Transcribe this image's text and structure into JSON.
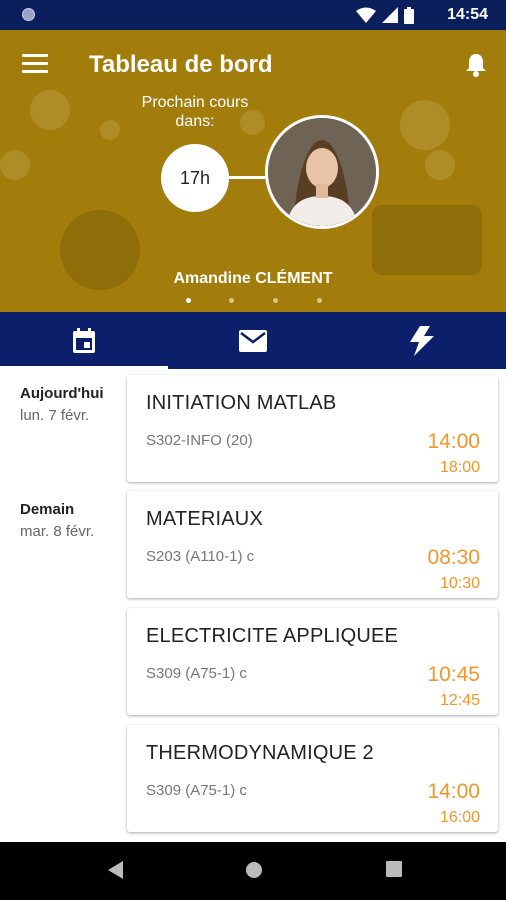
{
  "status_bar": {
    "time": "14:54"
  },
  "header": {
    "title": "Tableau de bord",
    "next_course_label": "Prochain cours dans:",
    "countdown": "17h",
    "teacher_name": "Amandine CLÉMENT",
    "pager_count": 4,
    "pager_active_index": 0,
    "background_color": "#a27d0c"
  },
  "tabs": [
    {
      "icon": "calendar-icon",
      "selected": true
    },
    {
      "icon": "mail-icon",
      "selected": false
    },
    {
      "icon": "lightning-icon",
      "selected": false
    }
  ],
  "schedule": {
    "days": [
      {
        "name": "Aujourd'hui",
        "date": "lun. 7 févr."
      },
      {
        "name": "Demain",
        "date": "mar. 8 févr."
      }
    ],
    "courses": [
      {
        "title": "INITIATION MATLAB",
        "room": "S302-INFO (20)",
        "start": "14:00",
        "end": "18:00"
      },
      {
        "title": "MATERIAUX",
        "room": "S203 (A110-1) c",
        "start": "08:30",
        "end": "10:30"
      },
      {
        "title": "ELECTRICITE APPLIQUEE",
        "room": "S309 (A75-1) c",
        "start": "10:45",
        "end": "12:45"
      },
      {
        "title": "THERMODYNAMIQUE 2",
        "room": "S309 (A75-1) c",
        "start": "14:00",
        "end": "16:00"
      }
    ]
  },
  "colors": {
    "primary": "#0b1f6b",
    "accent": "#f0962a",
    "header": "#a27d0c"
  }
}
